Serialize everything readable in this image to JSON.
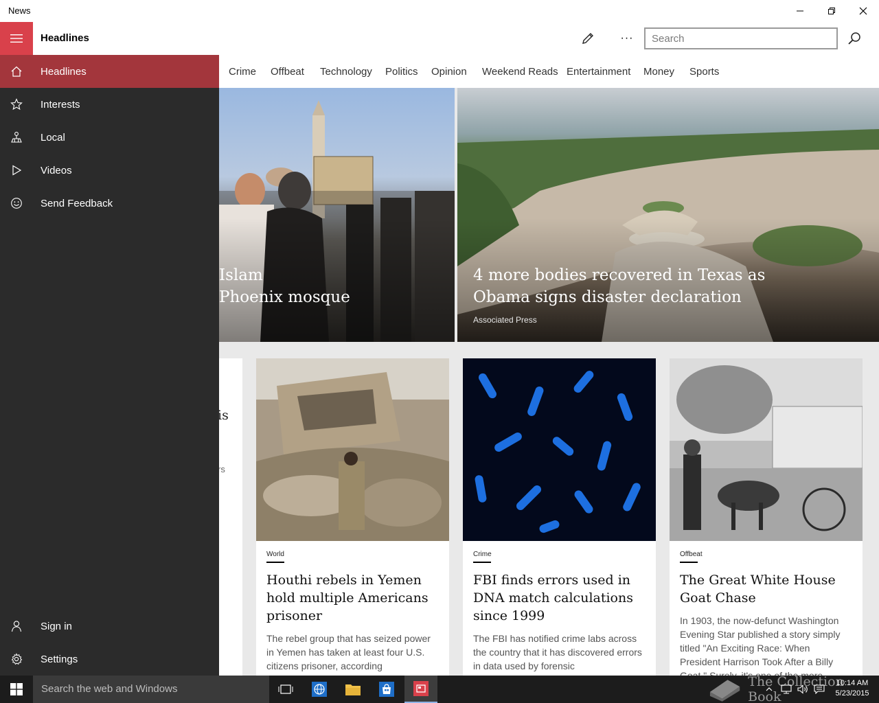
{
  "window": {
    "title": "News",
    "minimize_icon": "minimize-icon",
    "restore_icon": "restore-icon",
    "close_icon": "close-icon"
  },
  "header": {
    "page_title": "Headlines",
    "search_placeholder": "Search",
    "more_label": "···"
  },
  "tabs": [
    "Crime",
    "Offbeat",
    "Technology",
    "Politics",
    "Opinion",
    "Weekend Reads",
    "Entertainment",
    "Money",
    "Sports"
  ],
  "sidebar": {
    "items": [
      {
        "label": "Headlines",
        "icon": "home-icon",
        "selected": true
      },
      {
        "label": "Interests",
        "icon": "star-icon"
      },
      {
        "label": "Local",
        "icon": "local-icon"
      },
      {
        "label": "Videos",
        "icon": "play-icon"
      },
      {
        "label": "Send Feedback",
        "icon": "smiley-icon"
      }
    ],
    "footer": [
      {
        "label": "Sign in",
        "icon": "person-icon"
      },
      {
        "label": "Settings",
        "icon": "gear-icon"
      }
    ]
  },
  "hero": [
    {
      "headline_line1": "Islam",
      "headline_line2": "Phoenix mosque"
    },
    {
      "headline_line1": "4 more bodies recovered in Texas as",
      "headline_line2": "Obama signs disaster declaration",
      "source": "Associated Press"
    }
  ],
  "partial_card": {
    "fragment_1": "is",
    "fragment_2": "rs"
  },
  "cards": [
    {
      "category": "World",
      "title": "Houthi rebels in Yemen hold multiple Americans prisoner",
      "snippet": "The rebel group that has seized power in Yemen has taken at least four U.S. citizens prisoner, according"
    },
    {
      "category": "Crime",
      "title": "FBI finds errors used in DNA match calculations since 1999",
      "snippet": "The FBI has notified crime labs across the country that it has discovered errors in data used by forensic"
    },
    {
      "category": "Offbeat",
      "title": "The Great White House Goat Chase",
      "snippet": "In 1903, the now-defunct Washington Evening Star published a story simply titled \"An Exciting Race: When President Harrison Took After a Billy Goat.\" Surely, it's one of the more"
    }
  ],
  "taskbar": {
    "search_text": "Search the web and Windows",
    "time": "10:14 AM",
    "date": "5/23/2015",
    "watermark": "The Collection Book"
  }
}
